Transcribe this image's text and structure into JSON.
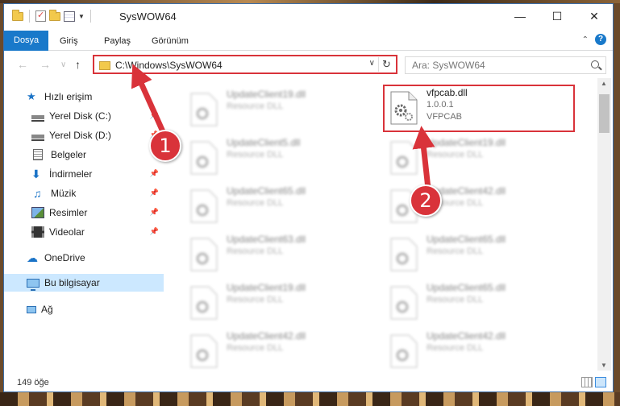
{
  "window": {
    "title": "SysWOW64"
  },
  "ribbon": {
    "tabs": [
      "Dosya",
      "Giriş",
      "Paylaş",
      "Görünüm"
    ]
  },
  "address": {
    "path": "C:\\Windows\\SysWOW64"
  },
  "search": {
    "placeholder": "Ara: SysWOW64"
  },
  "navpane": {
    "items": [
      {
        "label": "Hızlı erişim",
        "icon": "star-icon"
      },
      {
        "label": "Yerel Disk (C:)",
        "icon": "disk-icon"
      },
      {
        "label": "Yerel Disk (D:)",
        "icon": "disk-icon"
      },
      {
        "label": "Belgeler",
        "icon": "documents-icon"
      },
      {
        "label": "İndirmeler",
        "icon": "download-icon"
      },
      {
        "label": "Müzik",
        "icon": "music-icon"
      },
      {
        "label": "Resimler",
        "icon": "pictures-icon"
      },
      {
        "label": "Videolar",
        "icon": "video-icon"
      },
      {
        "label": "OneDrive",
        "icon": "cloud-icon"
      },
      {
        "label": "Bu bilgisayar",
        "icon": "pc-icon"
      },
      {
        "label": "Ağ",
        "icon": "network-icon"
      }
    ]
  },
  "files": {
    "highlighted": {
      "name": "vfpcab.dll",
      "version": "1.0.0.1",
      "description": "VFPCAB"
    },
    "left_column": [
      {
        "name": "UpdateClient19.dll",
        "type": "Resource DLL"
      },
      {
        "name": "UpdateClient5.dll",
        "type": "Resource DLL"
      },
      {
        "name": "UpdateClient65.dll",
        "type": "Resource DLL"
      },
      {
        "name": "UpdateClient63.dll",
        "type": "Resource DLL"
      },
      {
        "name": "UpdateClient19.dll",
        "type": "Resource DLL"
      },
      {
        "name": "UpdateClient42.dll",
        "type": "Resource DLL"
      }
    ],
    "right_column": [
      {
        "name": "UpdateClient19.dll",
        "type": "Resource DLL"
      },
      {
        "name": "UpdateClient42.dll",
        "type": "Resource DLL"
      },
      {
        "name": "UpdateClient65.dll",
        "type": "Resource DLL"
      },
      {
        "name": "UpdateClient65.dll",
        "type": "Resource DLL"
      },
      {
        "name": "UpdateClient42.dll",
        "type": "Resource DLL"
      }
    ]
  },
  "status": {
    "count": "149 öğe"
  },
  "annotations": {
    "callout1": "1",
    "callout2": "2"
  },
  "colors": {
    "accent": "#1979ca",
    "highlight": "#d9333a",
    "selected": "#cce8ff"
  }
}
